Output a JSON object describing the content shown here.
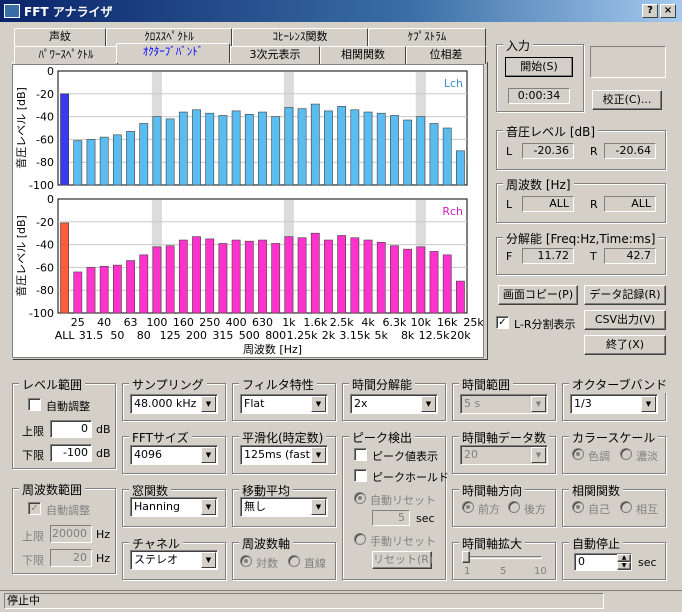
{
  "window": {
    "title": "FFT アナライザ",
    "help": "?",
    "close": "×"
  },
  "tabs": {
    "row1": [
      "声紋",
      "ｸﾛｽｽﾍﾟｸﾄﾙ",
      "ｺﾋｰﾚﾝｽ関数",
      "ｹﾌﾟｽﾄﾗﾑ"
    ],
    "row2": [
      "ﾊﾟﾜｰｽﾍﾟｸﾄﾙ",
      "ｵｸﾀｰﾌﾞﾊﾞﾝﾄﾞ",
      "3次元表示",
      "相関関数",
      "位相差"
    ],
    "active": "ｵｸﾀｰﾌﾞﾊﾞﾝﾄﾞ"
  },
  "chart_data": {
    "type": "bar",
    "ylabel": "音圧レベル [dB]",
    "xlabel": "周波数 [Hz]",
    "ylim": [
      -100,
      0
    ],
    "yticks": [
      "0",
      "-20",
      "-40",
      "-60",
      "-80",
      "-100"
    ],
    "xticks_top": [
      "25",
      "40",
      "63",
      "100",
      "160",
      "250",
      "400",
      "630",
      "1k",
      "1.6k",
      "2.5k",
      "4k",
      "6.3k",
      "10k",
      "16k",
      "25k"
    ],
    "xticks_bottom": [
      "ALL",
      "31.5",
      "50",
      "80",
      "125",
      "200",
      "315",
      "500",
      "800",
      "1.25k",
      "2k",
      "3.15k",
      "5k",
      "8k",
      "12.5k",
      "20k"
    ],
    "categories": [
      "ALL",
      "25",
      "31.5",
      "40",
      "50",
      "63",
      "80",
      "100",
      "125",
      "160",
      "200",
      "250",
      "315",
      "400",
      "500",
      "630",
      "800",
      "1k",
      "1.25k",
      "1.6k",
      "2k",
      "2.5k",
      "3.15k",
      "4k",
      "5k",
      "6.3k",
      "8k",
      "10k",
      "12.5k",
      "16k",
      "20k"
    ],
    "series": [
      {
        "name": "Lch",
        "color": "#5bbcf0",
        "all_color": "#3a3af0",
        "values": [
          -20,
          -61,
          -60,
          -58,
          -56,
          -53,
          -46,
          -40,
          -42,
          -36,
          -34,
          -37,
          -39,
          -35,
          -38,
          -36,
          -40,
          -32,
          -33,
          -29,
          -35,
          -31,
          -34,
          -36,
          -37,
          -39,
          -43,
          -40,
          -46,
          -50,
          -70
        ]
      },
      {
        "name": "Rch",
        "color": "#ff33cc",
        "all_color": "#ff5a3a",
        "values": [
          -21,
          -64,
          -60,
          -59,
          -58,
          -54,
          -49,
          -42,
          -41,
          -36,
          -33,
          -35,
          -39,
          -36,
          -37,
          -36,
          -39,
          -33,
          -34,
          -30,
          -36,
          -32,
          -34,
          -36,
          -38,
          -41,
          -44,
          -42,
          -46,
          -49,
          -72
        ]
      }
    ],
    "grid": true
  },
  "input": {
    "label": "入力",
    "start": "開始(S)",
    "time": "0:00:34",
    "calib": "校正(C)..."
  },
  "level": {
    "label": "音圧レベル [dB]",
    "l": "L",
    "l_val": "-20.36",
    "r": "R",
    "r_val": "-20.64"
  },
  "freq": {
    "label": "周波数 [Hz]",
    "l": "L",
    "l_val": "ALL",
    "r": "R",
    "r_val": "ALL"
  },
  "resolution": {
    "label": "分解能 [Freq:Hz,Time:ms]",
    "f": "F",
    "f_val": "11.72",
    "t": "T",
    "t_val": "42.7"
  },
  "buttons": {
    "copy": "画面コピー(P)",
    "record": "データ記録(R)",
    "lr_split": "L-R分割表示",
    "csv": "CSV出力(V)",
    "exit": "終了(X)"
  },
  "level_range": {
    "label": "レベル範囲",
    "auto": "自動調整",
    "upper": "上限",
    "upper_val": "0",
    "lower": "下限",
    "lower_val": "-100",
    "unit": "dB"
  },
  "freq_range": {
    "label": "周波数範囲",
    "auto": "自動調整",
    "upper": "上限",
    "upper_val": "20000",
    "lower": "下限",
    "lower_val": "20",
    "unit": "Hz"
  },
  "sampling": {
    "label": "サンプリング",
    "value": "48.000 kHz"
  },
  "fft_size": {
    "label": "FFTサイズ",
    "value": "4096"
  },
  "window_fn": {
    "label": "窓関数",
    "value": "Hanning"
  },
  "channel": {
    "label": "チャネル",
    "value": "ステレオ"
  },
  "filter": {
    "label": "フィルタ特性",
    "value": "Flat"
  },
  "smoothing": {
    "label": "平滑化(時定数)",
    "value": "125ms (fast)"
  },
  "moving_avg": {
    "label": "移動平均",
    "value": "無し"
  },
  "freq_axis": {
    "label": "周波数軸",
    "opt1": "対数",
    "opt2": "直線"
  },
  "time_res": {
    "label": "時間分解能",
    "value": "2x"
  },
  "peak": {
    "label": "ピーク検出",
    "show": "ピーク値表示",
    "hold": "ピークホールド",
    "auto_reset": "自動リセット",
    "reset_val": "5",
    "sec": "sec",
    "manual_reset": "手動リセット",
    "reset_btn": "リセット(R)"
  },
  "time_range": {
    "label": "時間範囲",
    "value": "5 s"
  },
  "time_axis_data": {
    "label": "時間軸データ数",
    "value": "20"
  },
  "time_dir": {
    "label": "時間軸方向",
    "opt1": "前方",
    "opt2": "後方"
  },
  "time_zoom": {
    "label": "時間軸拡大",
    "t1": "1",
    "t2": "5",
    "t3": "10"
  },
  "octave": {
    "label": "オクターブバンド",
    "value": "1/3"
  },
  "color_scale": {
    "label": "カラースケール",
    "opt1": "色調",
    "opt2": "濃淡"
  },
  "correlation": {
    "label": "相関関数",
    "opt1": "自己",
    "opt2": "相互"
  },
  "auto_stop": {
    "label": "自動停止",
    "value": "0",
    "unit": "sec"
  },
  "status": {
    "text": "停止中"
  }
}
